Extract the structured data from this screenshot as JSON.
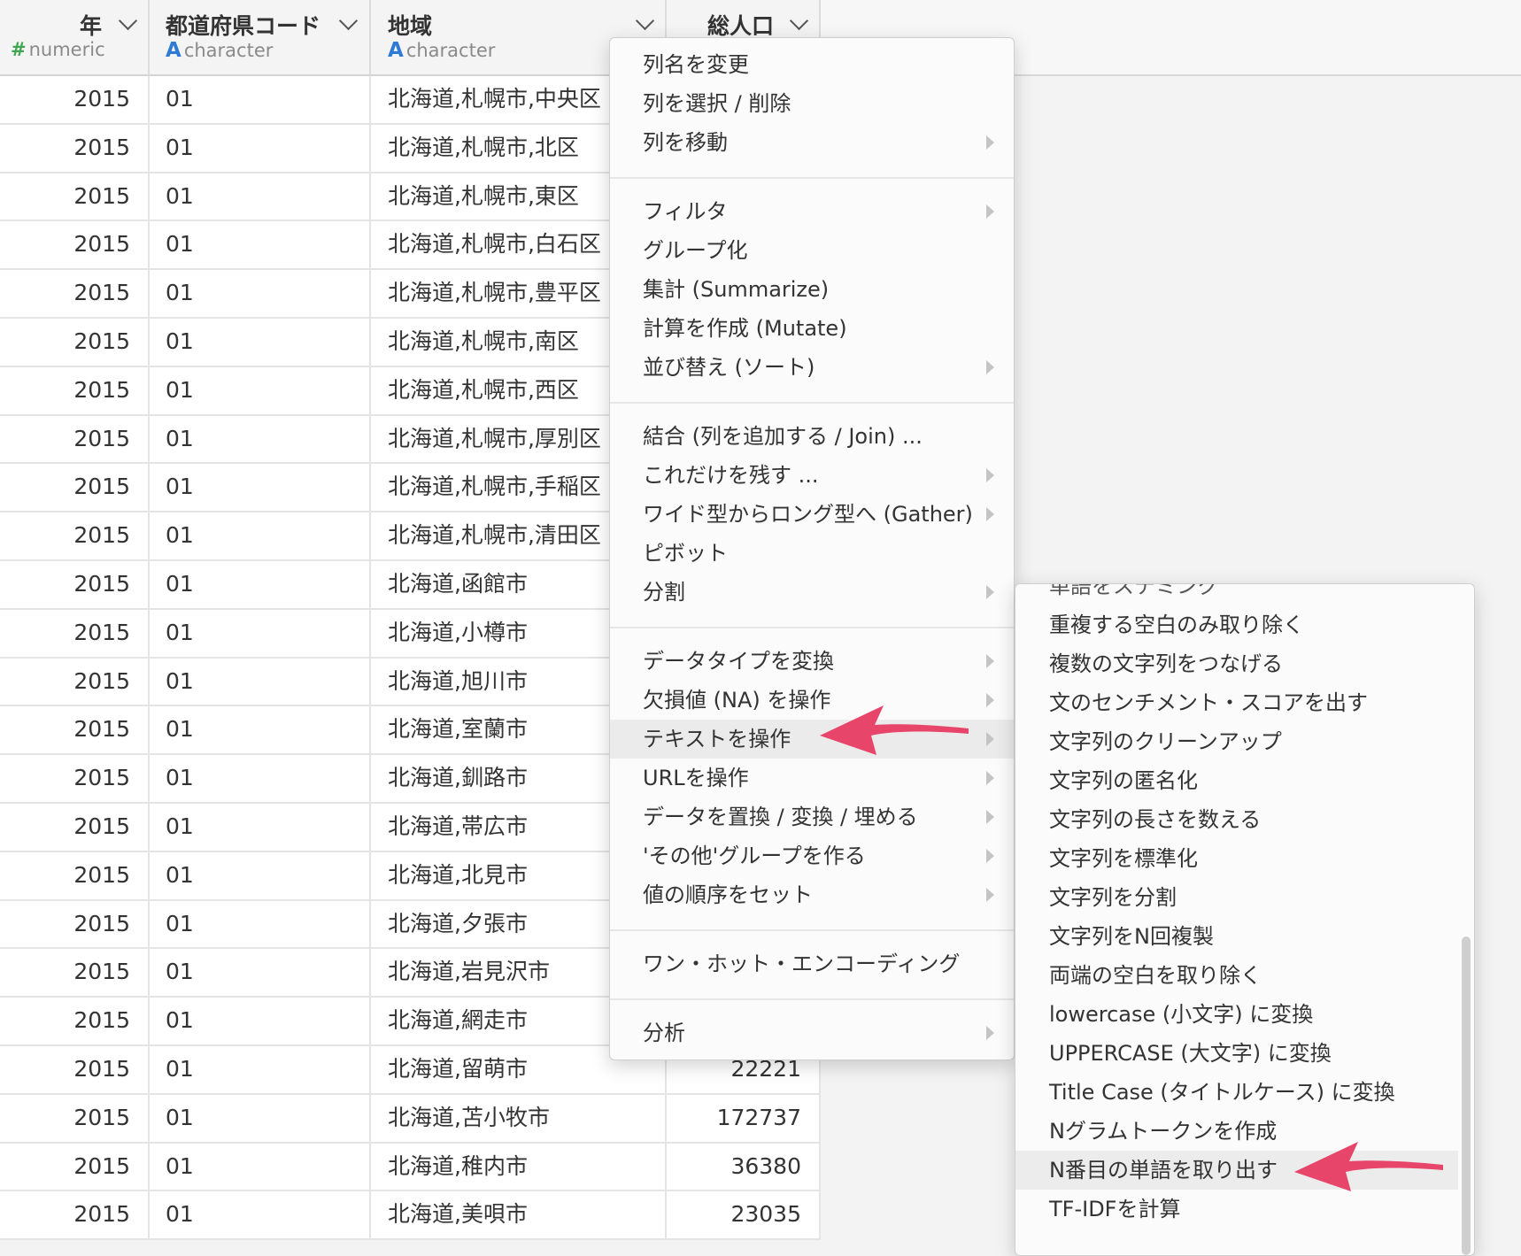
{
  "columns": [
    {
      "name": "年",
      "type_symbol": "#",
      "type": "numeric"
    },
    {
      "name": "都道府県コード",
      "type_symbol": "A",
      "type": "character"
    },
    {
      "name": "地域",
      "type_symbol": "A",
      "type": "character"
    },
    {
      "name": "総人口",
      "type_symbol": "",
      "type": ""
    }
  ],
  "rows": [
    {
      "year": "2015",
      "pref": "01",
      "area": "北海道,札幌市,中央区",
      "pop": ""
    },
    {
      "year": "2015",
      "pref": "01",
      "area": "北海道,札幌市,北区",
      "pop": ""
    },
    {
      "year": "2015",
      "pref": "01",
      "area": "北海道,札幌市,東区",
      "pop": ""
    },
    {
      "year": "2015",
      "pref": "01",
      "area": "北海道,札幌市,白石区",
      "pop": ""
    },
    {
      "year": "2015",
      "pref": "01",
      "area": "北海道,札幌市,豊平区",
      "pop": ""
    },
    {
      "year": "2015",
      "pref": "01",
      "area": "北海道,札幌市,南区",
      "pop": ""
    },
    {
      "year": "2015",
      "pref": "01",
      "area": "北海道,札幌市,西区",
      "pop": ""
    },
    {
      "year": "2015",
      "pref": "01",
      "area": "北海道,札幌市,厚別区",
      "pop": ""
    },
    {
      "year": "2015",
      "pref": "01",
      "area": "北海道,札幌市,手稲区",
      "pop": ""
    },
    {
      "year": "2015",
      "pref": "01",
      "area": "北海道,札幌市,清田区",
      "pop": ""
    },
    {
      "year": "2015",
      "pref": "01",
      "area": "北海道,函館市",
      "pop": ""
    },
    {
      "year": "2015",
      "pref": "01",
      "area": "北海道,小樽市",
      "pop": ""
    },
    {
      "year": "2015",
      "pref": "01",
      "area": "北海道,旭川市",
      "pop": ""
    },
    {
      "year": "2015",
      "pref": "01",
      "area": "北海道,室蘭市",
      "pop": ""
    },
    {
      "year": "2015",
      "pref": "01",
      "area": "北海道,釧路市",
      "pop": ""
    },
    {
      "year": "2015",
      "pref": "01",
      "area": "北海道,帯広市",
      "pop": ""
    },
    {
      "year": "2015",
      "pref": "01",
      "area": "北海道,北見市",
      "pop": ""
    },
    {
      "year": "2015",
      "pref": "01",
      "area": "北海道,夕張市",
      "pop": ""
    },
    {
      "year": "2015",
      "pref": "01",
      "area": "北海道,岩見沢市",
      "pop": ""
    },
    {
      "year": "2015",
      "pref": "01",
      "area": "北海道,網走市",
      "pop": ""
    },
    {
      "year": "2015",
      "pref": "01",
      "area": "北海道,留萌市",
      "pop": "22221"
    },
    {
      "year": "2015",
      "pref": "01",
      "area": "北海道,苫小牧市",
      "pop": "172737"
    },
    {
      "year": "2015",
      "pref": "01",
      "area": "北海道,稚内市",
      "pop": "36380"
    },
    {
      "year": "2015",
      "pref": "01",
      "area": "北海道,美唄市",
      "pop": "23035"
    }
  ],
  "menu": {
    "items": [
      {
        "label": "列名を変更",
        "submenu": false
      },
      {
        "label": "列を選択 / 削除",
        "submenu": false
      },
      {
        "label": "列を移動",
        "submenu": true
      },
      {
        "label": "フィルタ",
        "submenu": true
      },
      {
        "label": "グループ化",
        "submenu": false
      },
      {
        "label": "集計 (Summarize)",
        "submenu": false
      },
      {
        "label": "計算を作成 (Mutate)",
        "submenu": false
      },
      {
        "label": "並び替え (ソート)",
        "submenu": true
      },
      {
        "label": "結合 (列を追加する / Join) ...",
        "submenu": false
      },
      {
        "label": "これだけを残す ...",
        "submenu": true
      },
      {
        "label": "ワイド型からロング型へ (Gather)",
        "submenu": true
      },
      {
        "label": "ピボット",
        "submenu": false
      },
      {
        "label": "分割",
        "submenu": true
      },
      {
        "label": "データタイプを変換",
        "submenu": true
      },
      {
        "label": "欠損値 (NA) を操作",
        "submenu": true
      },
      {
        "label": "テキストを操作",
        "submenu": true
      },
      {
        "label": "URLを操作",
        "submenu": true
      },
      {
        "label": "データを置換 / 変換 / 埋める",
        "submenu": true
      },
      {
        "label": "'その他'グループを作る",
        "submenu": true
      },
      {
        "label": "値の順序をセット",
        "submenu": true
      },
      {
        "label": "ワン・ホット・エンコーディング",
        "submenu": false
      },
      {
        "label": "分析",
        "submenu": true
      }
    ]
  },
  "submenu": {
    "cut_label": "単語をステミング",
    "items": [
      "重複する空白のみ取り除く",
      "複数の文字列をつなげる",
      "文のセンチメント・スコアを出す",
      "文字列のクリーンアップ",
      "文字列の匿名化",
      "文字列の長さを数える",
      "文字列を標準化",
      "文字列を分割",
      "文字列をN回複製",
      "両端の空白を取り除く",
      "lowercase (小文字) に変換",
      "UPPERCASE (大文字) に変換",
      "Title Case (タイトルケース) に変換",
      "Nグラムトークンを作成",
      "N番目の単語を取り出す",
      "TF-IDFを計算"
    ]
  },
  "colors": {
    "annotation_arrow": "#e8456b",
    "numeric_icon": "#3ea650",
    "character_icon": "#2e7bd6"
  }
}
